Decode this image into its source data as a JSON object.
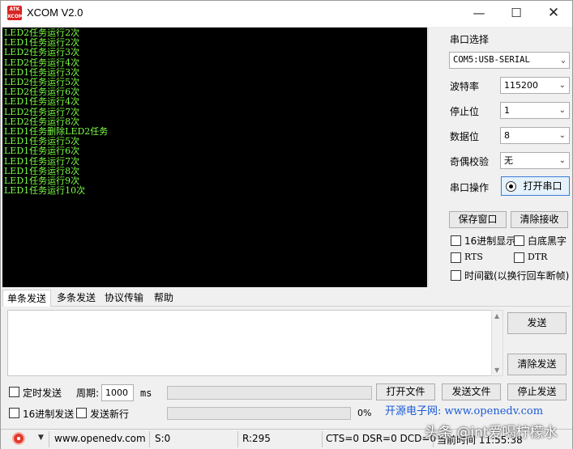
{
  "window": {
    "logo_top": "ATK",
    "logo_bottom": "XCOM",
    "title": "XCOM V2.0",
    "min_icon": "minimize-icon",
    "max_icon": "maximize-icon",
    "close_icon": "close-icon"
  },
  "receive": {
    "lines": [
      "LED2任务运行2次",
      "LED1任务运行2次",
      "LED2任务运行3次",
      "LED2任务运行4次",
      "LED1任务运行3次",
      "LED2任务运行5次",
      "LED2任务运行6次",
      "LED1任务运行4次",
      "LED2任务运行7次",
      "LED2任务运行8次",
      "LED1任务删除LED2任务",
      "LED1任务运行5次",
      "LED1任务运行6次",
      "LED1任务运行7次",
      "LED1任务运行8次",
      "LED1任务运行9次",
      "LED1任务运行10次"
    ],
    "text_color": "#7cff45",
    "background": "#000000"
  },
  "settings": {
    "port_label": "串口选择",
    "port_value": "COM5:USB-SERIAL",
    "baud_label": "波特率",
    "baud_value": "115200",
    "stop_label": "停止位",
    "stop_value": "1",
    "data_label": "数据位",
    "data_value": "8",
    "parity_label": "奇偶校验",
    "parity_value": "无",
    "op_label": "串口操作",
    "open_button": "打开串口",
    "save_button": "保存窗口",
    "clear_recv_button": "清除接收",
    "hex_display": "16进制显示",
    "white_bg": "白底黑字",
    "rts": "RTS",
    "dtr": "DTR",
    "timestamp": "时间戳(以换行回车断帧)"
  },
  "tabs": [
    {
      "label": "单条发送",
      "active": true
    },
    {
      "label": "多条发送",
      "active": false
    },
    {
      "label": "协议传输",
      "active": false
    },
    {
      "label": "帮助",
      "active": false
    }
  ],
  "send": {
    "send_button": "发送",
    "clear_send_button": "清除发送",
    "timed_send": "定时发送",
    "period_label": "周期:",
    "period_value": "1000",
    "period_unit": "ms",
    "open_file_button": "打开文件",
    "send_file_button": "发送文件",
    "stop_send_button": "停止发送",
    "hex_send": "16进制发送",
    "newline": "发送新行",
    "percent": "0%",
    "site_text": "开源电子网: www.openedv.com"
  },
  "status": {
    "url": "www.openedv.com",
    "sent": "S:0",
    "received": "R:295",
    "lines": "CTS=0 DSR=0 DCD=0",
    "time": "当前时间 11:55:38",
    "watermark": "头条 @int爱喝柠檬水"
  }
}
